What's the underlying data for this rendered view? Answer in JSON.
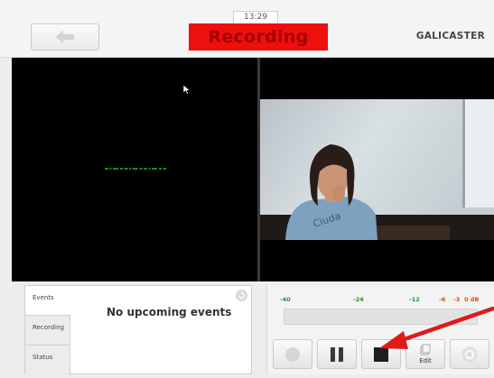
{
  "header": {
    "clock": "13:29",
    "status": "Recording",
    "logo": "GALICASTER",
    "back_icon": "arrow-left-icon"
  },
  "events": {
    "tabs": [
      "Events",
      "Recording",
      "Status"
    ],
    "message": "No upcoming events",
    "refresh_icon": "refresh-icon"
  },
  "audio": {
    "scale": [
      "-40",
      "-24",
      "-12",
      "-6",
      "-3",
      "0 dB"
    ],
    "scale_colors": [
      "#2f8f2f",
      "#2f8f2f",
      "#2f8f2f",
      "#e04a1a",
      "#e04a1a",
      "#e04a1a"
    ]
  },
  "controls": {
    "edit_label": "Edit",
    "icons": [
      "record-icon",
      "pause-icon",
      "stop-icon",
      "edit-icon",
      "help-icon"
    ]
  },
  "colors": {
    "recording_bg": "#ee0f0f",
    "recording_text": "#a50000",
    "annotation_arrow": "#e01919"
  }
}
